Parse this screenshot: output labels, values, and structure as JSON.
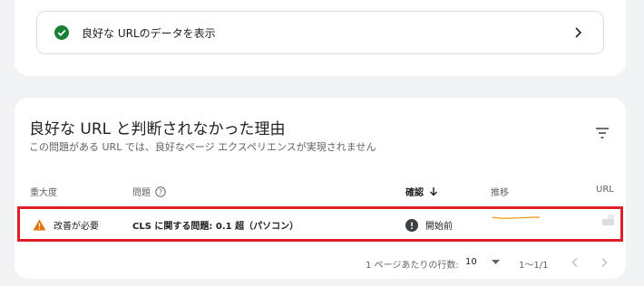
{
  "good_urls": {
    "label": "良好な URLのデータを表示"
  },
  "section": {
    "title": "良好な URL と判断されなかった理由",
    "subtitle": "この問題がある URL では、良好なページ エクスペリエンスが実現されません"
  },
  "table": {
    "headers": {
      "severity": "重大度",
      "issue": "問題",
      "validation": "確認",
      "trend": "推移",
      "url": "URL"
    },
    "rows": [
      {
        "severity": "改善が必要",
        "issue": "CLS に関する問題: 0.1 超（パソコン）",
        "validation": "開始前"
      }
    ]
  },
  "pagination": {
    "rows_per_page_label": "1 ページあたりの行数:",
    "rows_per_page_value": "10",
    "range": "1〜1/1"
  },
  "colors": {
    "success": "#188038",
    "warning": "#e37400",
    "highlight": "#e11d2a",
    "trend_line": "#f29900"
  }
}
